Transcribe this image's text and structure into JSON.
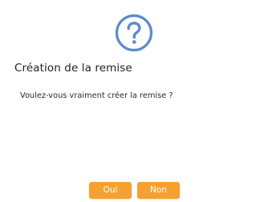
{
  "dialog": {
    "icon": "question-circle-icon",
    "icon_color": "#5b8cc7",
    "title": "Création de la remise",
    "message": "Voulez-vous vraiment créer la remise ?",
    "buttons": {
      "yes_label": "Oui",
      "no_label": "Non"
    },
    "button_color": "#f6a12f"
  }
}
